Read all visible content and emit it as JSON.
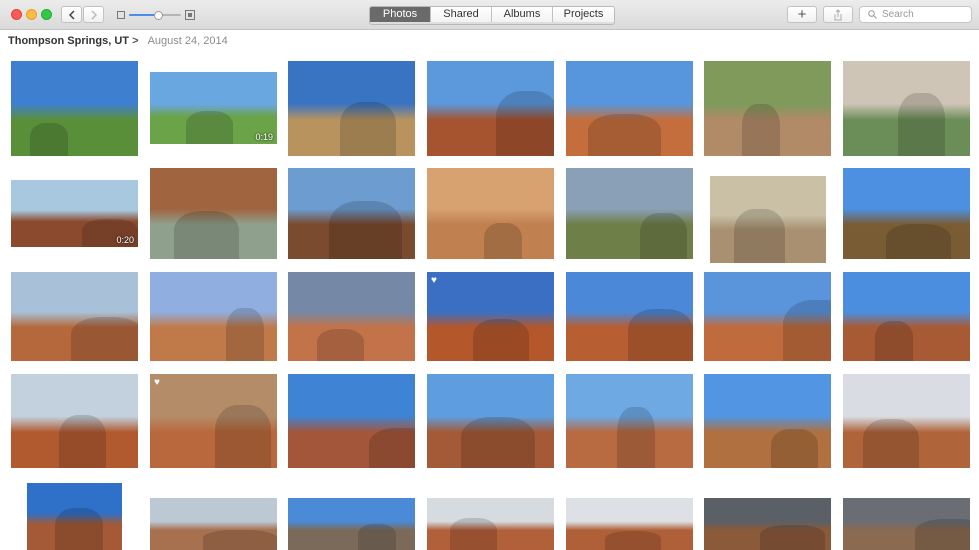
{
  "toolbar": {
    "tabs": [
      "Photos",
      "Shared",
      "Albums",
      "Projects"
    ],
    "active_tab": "Photos",
    "search_placeholder": "Search",
    "add_label": "+"
  },
  "breadcrumb": {
    "location": "Thompson Springs, UT",
    "chevron": ">",
    "date": "August 24, 2014"
  },
  "zoom_level": 0.55,
  "photos": [
    {
      "subject": "rider on horse",
      "sky": "#3f7fd0",
      "ground": "#5a8f3a"
    },
    {
      "subject": "rider on horse",
      "sky": "#69a7e0",
      "ground": "#6aa348",
      "duration": "0:19"
    },
    {
      "subject": "rider on horse",
      "sky": "#3974c2",
      "ground": "#b8935e"
    },
    {
      "subject": "canyon overlook",
      "sky": "#5b98dc",
      "ground": "#a6542f"
    },
    {
      "subject": "desert buttes",
      "sky": "#5796dd",
      "ground": "#c46e3d"
    },
    {
      "subject": "man in canyon",
      "sky": "#7f9a5a",
      "ground": "#b18a68"
    },
    {
      "subject": "creek wading",
      "sky": "#cfc5b6",
      "ground": "#6b8d58"
    },
    {
      "subject": "slot canyon",
      "sky": "#a8c8e0",
      "ground": "#8b4a2e",
      "duration": "0:20"
    },
    {
      "subject": "man in waterfall pool",
      "sky": "#a0643f",
      "ground": "#8fa08c"
    },
    {
      "subject": "canyon stream",
      "sky": "#6d9cd1",
      "ground": "#7a4b2e"
    },
    {
      "subject": "sand ripples",
      "sky": "#d8a170",
      "ground": "#c08050"
    },
    {
      "subject": "canyon stream",
      "sky": "#8aa0b6",
      "ground": "#6f7f48"
    },
    {
      "subject": "girl in creek",
      "sky": "#c9c0a5",
      "ground": "#a89070"
    },
    {
      "subject": "creek rocks",
      "sky": "#4d8fe0",
      "ground": "#7a5c34"
    },
    {
      "subject": "rider below butte",
      "sky": "#a9c1d8",
      "ground": "#b4683c"
    },
    {
      "subject": "couple in desert",
      "sky": "#90aee0",
      "ground": "#c07a4a"
    },
    {
      "subject": "red rock dome",
      "sky": "#7588a6",
      "ground": "#c2734a"
    },
    {
      "subject": "rock arch",
      "sky": "#3a6fc4",
      "ground": "#b4582c",
      "favorite": true
    },
    {
      "subject": "woman by arch",
      "sky": "#4b88d8",
      "ground": "#b75e32"
    },
    {
      "subject": "man selfie",
      "sky": "#5a95dc",
      "ground": "#c06b3e"
    },
    {
      "subject": "arch landscape",
      "sky": "#4b8ee0",
      "ground": "#a85a34"
    },
    {
      "subject": "woman under arch",
      "sky": "#c3d1de",
      "ground": "#b15a30"
    },
    {
      "subject": "couple selfie",
      "sky": "#b58c68",
      "ground": "#b8683c",
      "favorite": true
    },
    {
      "subject": "hiker on ridge",
      "sky": "#3f83d4",
      "ground": "#a4563a"
    },
    {
      "subject": "arch with hiker",
      "sky": "#5e9ee0",
      "ground": "#a45a36"
    },
    {
      "subject": "hiker on rock",
      "sky": "#6ea9e4",
      "ground": "#b86a40"
    },
    {
      "subject": "man by arch",
      "sky": "#5295e2",
      "ground": "#b0703f"
    },
    {
      "subject": "couple by arch",
      "sky": "#d9dde3",
      "ground": "#b0643a"
    },
    {
      "subject": "arch peak",
      "sky": "#2f70c8",
      "ground": "#a45a36"
    },
    {
      "subject": "cloudy desert",
      "sky": "#bcc8d4",
      "ground": "#a7704e"
    },
    {
      "subject": "dancer with scarf",
      "sky": "#4a8ad6",
      "ground": "#7b6a5a"
    },
    {
      "subject": "red spires",
      "sky": "#d6dbe0",
      "ground": "#b2603a"
    },
    {
      "subject": "red spires",
      "sky": "#dde1e5",
      "ground": "#b06038"
    },
    {
      "subject": "woman under storm",
      "sky": "#5b5f66",
      "ground": "#8a5a3a"
    },
    {
      "subject": "storm sky",
      "sky": "#6a6e74",
      "ground": "#8a6a50"
    }
  ]
}
